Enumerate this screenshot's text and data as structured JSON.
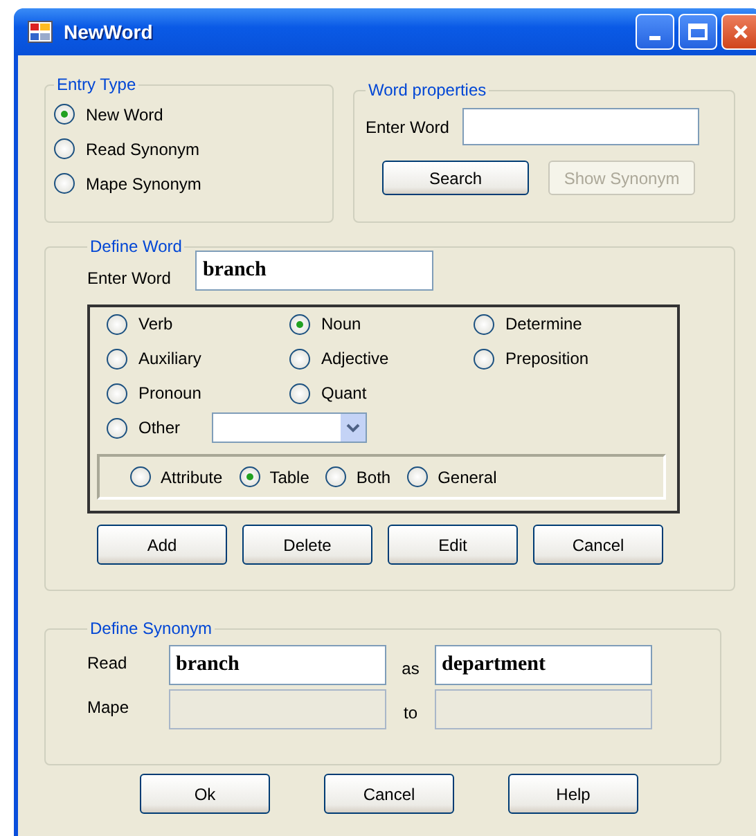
{
  "window": {
    "title": "NewWord"
  },
  "entry_type": {
    "title": "Entry Type",
    "options": [
      {
        "label": "New Word",
        "selected": true
      },
      {
        "label": "Read Synonym",
        "selected": false
      },
      {
        "label": "Mape Synonym",
        "selected": false
      }
    ]
  },
  "word_properties": {
    "title": "Word properties",
    "label": "Enter Word",
    "buttons": [
      {
        "label": "Search",
        "disabled": false
      },
      {
        "label": "Show Synonym",
        "disabled": true
      }
    ]
  },
  "define_word": {
    "title": "Define Word",
    "label": "Enter Word",
    "value": "branch",
    "parts_of_speech": [
      {
        "label": "Verb",
        "selected": false
      },
      {
        "label": "Noun",
        "selected": true
      },
      {
        "label": "Determine",
        "selected": false
      },
      {
        "label": "Auxiliary",
        "selected": false
      },
      {
        "label": "Adjective",
        "selected": false
      },
      {
        "label": "Preposition",
        "selected": false
      },
      {
        "label": "Pronoun",
        "selected": false
      },
      {
        "label": "Quant",
        "selected": false
      }
    ],
    "other": {
      "label": "Other",
      "selected": false
    },
    "scope": [
      {
        "label": "Attribute",
        "selected": false
      },
      {
        "label": "Table",
        "selected": true
      },
      {
        "label": "Both",
        "selected": false
      },
      {
        "label": "General",
        "selected": false
      }
    ],
    "buttons": [
      "Add",
      "Delete",
      "Edit",
      "Cancel"
    ]
  },
  "define_synonym": {
    "title": "Define Synonym",
    "rows": [
      {
        "label": "Read",
        "value": "branch",
        "joiner": "as",
        "target": "department",
        "disabled": false
      },
      {
        "label": "Mape",
        "joiner": "to",
        "disabled": true
      }
    ]
  },
  "buttons": [
    "Ok",
    "Cancel",
    "Help"
  ]
}
